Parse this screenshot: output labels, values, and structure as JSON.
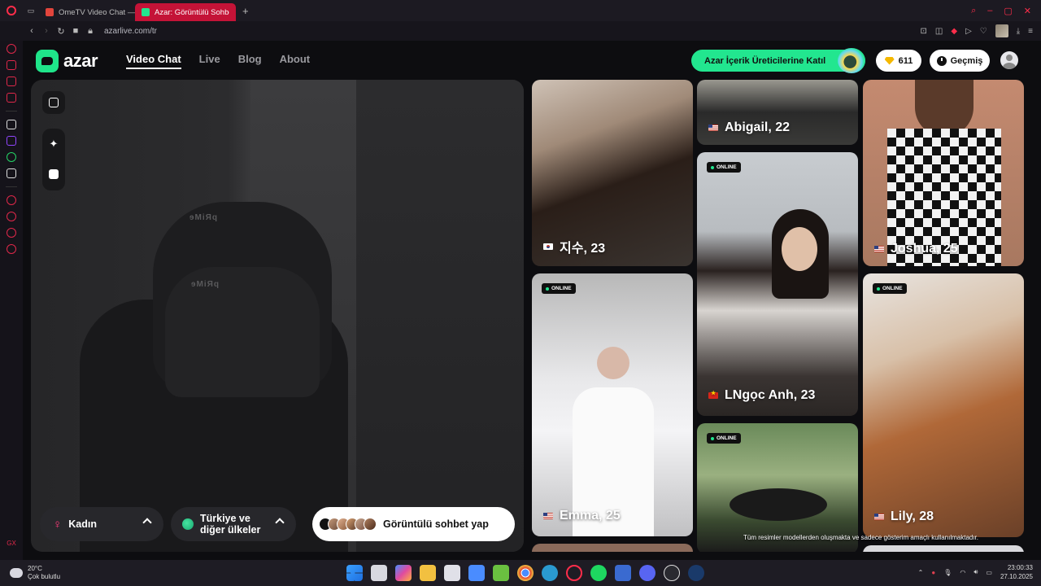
{
  "browser": {
    "tabs": [
      {
        "label": "OmeTV Video Chat — Om",
        "active": false,
        "favicon_color": "#e2453c"
      },
      {
        "label": "Azar: Görüntülü Sohbet, Y",
        "active": true,
        "favicon_color": "#22e68f"
      }
    ],
    "new_tab": "+",
    "url": "azarlive.com/tr"
  },
  "header": {
    "logo": "azar",
    "nav": [
      {
        "label": "Video Chat",
        "active": true
      },
      {
        "label": "Live",
        "active": false
      },
      {
        "label": "Blog",
        "active": false
      },
      {
        "label": "About",
        "active": false
      }
    ],
    "creator_button": "Azar İçerik Üreticilerine Katıl",
    "gems": "611",
    "history": "Geçmiş"
  },
  "camera": {
    "chair_text": "pRiMe",
    "gender": "Kadın",
    "country_line1": "Türkiye ve",
    "country_line2": "diğer ülkeler",
    "cta": "Görüntülü sohbet yap"
  },
  "profiles": [
    {
      "name": "지수, 23",
      "flag": "kr",
      "online": false
    },
    {
      "name": "Abigail, 22",
      "flag": "us",
      "online": false
    },
    {
      "name": "Joshua, 25",
      "flag": "us",
      "online": false
    },
    {
      "name": "LNgọc Anh, 23",
      "flag": "vn",
      "online": true
    },
    {
      "name": "Emma, 25",
      "flag": "us",
      "online": true
    },
    {
      "name": "Lily, 28",
      "flag": "us",
      "online": true
    },
    {
      "name": "",
      "flag": "",
      "online": true
    }
  ],
  "online_label": "ONLINE",
  "disclaimer": "Tüm resimler modellerden oluşmakta ve sadece gösterim amaçlı kullanılmaktadır.",
  "taskbar": {
    "temperature": "20°C",
    "weather": "Çok bulutlu",
    "time": "23:00:33",
    "date": "27.10.2025"
  },
  "colors": {
    "accent": "#22e68f",
    "opera": "#ff2d4a",
    "tab_active": "#c41337"
  }
}
